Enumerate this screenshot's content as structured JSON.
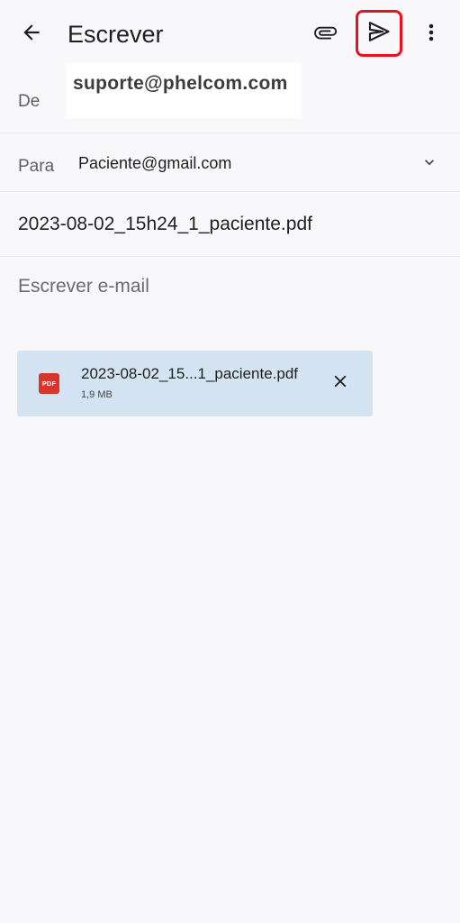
{
  "app_bar": {
    "title": "Escrever",
    "icons": {
      "back": "arrow-back-icon",
      "attach": "paperclip-icon",
      "send": "send-icon",
      "more": "more-vert-icon"
    },
    "send_highlight_color": "#e8121f"
  },
  "from": {
    "label": "De",
    "value": "suporte@phelcom.com"
  },
  "to": {
    "label": "Para",
    "value": "Paciente@gmail.com",
    "expand_icon": "chevron-down-icon"
  },
  "subject": {
    "value": "2023-08-02_15h24_1_paciente.pdf"
  },
  "body": {
    "placeholder": "Escrever e-mail"
  },
  "attachment": {
    "icon_label": "PDF",
    "name": "2023-08-02_15...1_paciente.pdf",
    "size": "1,9 MB",
    "background_color": "#d3e3f1",
    "icon_color": "#d9352b",
    "remove_icon": "close-icon"
  }
}
